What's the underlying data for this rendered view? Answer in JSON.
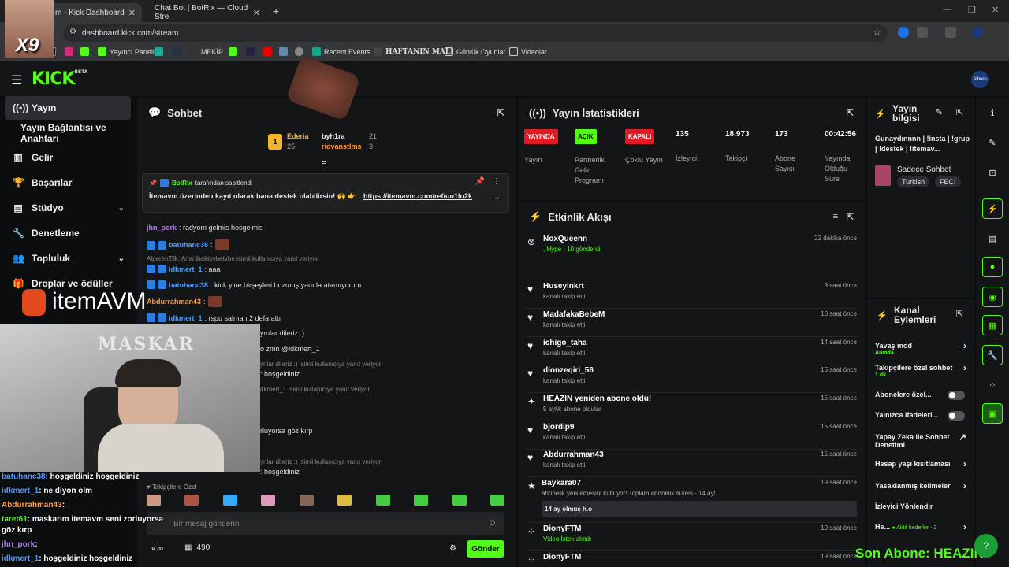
{
  "browser": {
    "tabs": [
      {
        "label": "m - Kick Dashboard"
      },
      {
        "label": "Chat Bot | BotRix — Cloud Stre"
      }
    ],
    "url": "dashboard.kick.com/stream",
    "bookmarks": [
      "Yayıncı Paneli",
      "MEKİP",
      "Recent Events",
      "HAFTANIN MALI",
      "Günlük Oyunlar",
      "Videolar"
    ]
  },
  "kick": {
    "logo": "KICK",
    "logo_sup": "BETA",
    "avatar_label": "Alburo"
  },
  "sidebar": {
    "items": [
      {
        "label": "Yayın",
        "icon": "broadcast-icon"
      },
      {
        "label": "Yayın Bağlantısı ve Anahtarı",
        "icon": ""
      },
      {
        "label": "Gelir",
        "icon": "chart-icon"
      },
      {
        "label": "Başarılar",
        "icon": "trophy-icon"
      },
      {
        "label": "Stüdyo",
        "icon": "studio-icon"
      },
      {
        "label": "Denetleme",
        "icon": "wrench-icon"
      },
      {
        "label": "Topluluk",
        "icon": "people-icon"
      },
      {
        "label": "Droplar ve ödüller",
        "icon": "gift-icon"
      }
    ]
  },
  "chat": {
    "title": "Sohbet",
    "leaders": [
      {
        "rank": "1",
        "name": "Ederia",
        "value": "25"
      },
      {
        "name": "byh1ra",
        "value": "21"
      },
      {
        "name": "ridvanstlms",
        "value": "3"
      }
    ],
    "pinned": {
      "by": "BotRix",
      "by_suffix": "tarafından sabitlendi",
      "text": "İtemavm üzerinden kayıt olarak bana destek olabilirsin! 🙌 👉",
      "link": "https://itemavm.com/ref/uo1lu2k"
    },
    "lines": [
      {
        "user": "jhn_pork",
        "text": ": radyom gelmis hosgelmis",
        "color": "#b874ff"
      },
      {
        "user": "batuhanc38",
        "text": ":",
        "color": "#4f9cff"
      },
      {
        "reply": "AlperenTilk: Ananibaktovbetvbe isimli kullanıcıya yanıt veriyor"
      },
      {
        "user": "idkmert_1",
        "text": ": aaa",
        "color": "#4f9cff"
      },
      {
        "user": "batuhanc38",
        "text": ": kick yine birşeyleri bozmuş yanıtla atamıyorum",
        "color": "#4f9cff"
      },
      {
        "user": "Abdurrahman43",
        "text": ":",
        "color": "#ff9a3c"
      },
      {
        "user": "idkmert_1",
        "text": ": rspu salman 2 defa attı",
        "color": "#4f9cff"
      },
      {
        "user": "",
        "text": "yınlar dileriz :)",
        "color": "#ddd"
      },
      {
        "user": "",
        "text": "o zmn @idkmert_1",
        "color": "#ddd"
      },
      {
        "reply": "ynlar dileriz :) isimli kullanıcıya yanıt veriyor"
      },
      {
        "user": "",
        "text": ": hoşgeldiniz",
        "color": "#ddd"
      },
      {
        "reply": "dkmert_1 isimli kullanıcıya yanıt veriyor"
      },
      {
        "user": "",
        "text": "rluyorsa göz kırp",
        "color": "#ddd"
      },
      {
        "reply": "ynlar dileriz :) isimli kullanıcıya yanıt veriyor"
      },
      {
        "user": "",
        "text": ": hoşgeldiniz",
        "color": "#ddd"
      }
    ],
    "emote_label": "Takipçilere Özel",
    "input_placeholder": "Bir mesaj gönderin",
    "points": "490",
    "send_label": "Gönder"
  },
  "stats": {
    "title": "Yayın İstatistikleri",
    "items": [
      {
        "pill": "YAYINDA",
        "pill_color": "#e01b24",
        "label": "Yayın"
      },
      {
        "pill": "AÇIK",
        "pill_color": "#53fc18",
        "label": "Partnerlik Gelir Programı"
      },
      {
        "pill": "KAPALI",
        "pill_color": "#e01b24",
        "label": "Çoklu Yayın"
      },
      {
        "value": "135",
        "label": "İzleyici"
      },
      {
        "value": "18.973",
        "label": "Takipçi"
      },
      {
        "value": "173",
        "label": "Abone Sayısı"
      },
      {
        "value": "00:42:56",
        "label": "Yayında Olduğu Süre"
      }
    ]
  },
  "activity": {
    "title": "Etkinlik Akışı",
    "items": [
      {
        "who": "NoxQueenn",
        "what": ", Hype · 10 gönderdi",
        "when": "22 dakika önce",
        "icon": "kick-icon"
      },
      {
        "who": "Huseyinkrt",
        "what": "kanalı takip etti",
        "when": "9 saat önce",
        "icon": "heart-icon"
      },
      {
        "who": "MadafakaBebeM",
        "what": "kanalı takip etti",
        "when": "10 saat önce",
        "icon": "heart-icon"
      },
      {
        "who": "ichigo_taha",
        "what": "kanalı takip etti",
        "when": "14 saat önce",
        "icon": "heart-icon"
      },
      {
        "who": "dionzeqiri_56",
        "what": "kanalı takip etti",
        "when": "15 saat önce",
        "icon": "heart-icon"
      },
      {
        "who": "HEAZIN yeniden abone oldu!",
        "what": "5 aylık abone oldular",
        "when": "15 saat önce",
        "icon": "sparkle-icon"
      },
      {
        "who": "bjordip9",
        "what": "kanalı takip etti",
        "when": "15 saat önce",
        "icon": "heart-icon"
      },
      {
        "who": "Abdurrahman43",
        "what": "kanalı takip etti",
        "when": "15 saat önce",
        "icon": "heart-icon"
      },
      {
        "who": "Baykara07",
        "what": "abonelik yenilemesini kutluyor! Toplam abonelik süresi - 14 ay!",
        "when": "19 saat önce",
        "icon": "star-icon",
        "note": "14 ay olmuş h.o"
      },
      {
        "who": "DionyFTM",
        "what": "Video İstek alındı",
        "when": "19 saat önce",
        "icon": "dots-icon"
      },
      {
        "who": "DionyFTM",
        "what": "",
        "when": "19 saat önce",
        "icon": "dots-icon"
      }
    ]
  },
  "info": {
    "title": "Yayın bilgisi",
    "stream_title": "Gunaydınnnn | !insta | !grup | !destek | !itemav...",
    "category": "Sadece Sohbet",
    "tags": [
      "Turkish",
      "FECİ"
    ]
  },
  "actions": {
    "title": "Kanal Eylemleri",
    "rows": [
      {
        "label": "Yavaş mod",
        "sub": "Anında",
        "ctl": "arrow"
      },
      {
        "label": "Takipçilere özel sohbet",
        "sub": "1 dk.",
        "ctl": "arrow"
      },
      {
        "label": "Abonelere özel...",
        "sub": "",
        "ctl": "toggle"
      },
      {
        "label": "Yalnızca ifadeleri...",
        "sub": "",
        "ctl": "toggle"
      },
      {
        "label": "Yapay Zeka ile Sohbet Denetimi",
        "sub": "",
        "ctl": "ext"
      },
      {
        "label": "Hesap yaşı kısıtlaması",
        "sub": "",
        "ctl": "arrow"
      },
      {
        "label": "Yasaklanmış kelimeler",
        "sub": "",
        "ctl": "arrow"
      },
      {
        "label": "İzleyici Yönlendir",
        "sub": "",
        "ctl": ""
      },
      {
        "label": "He...",
        "sub": "Aktif hedefler - 2",
        "ctl": "arrow"
      }
    ]
  },
  "overlay": {
    "brand": "itemAVM",
    "watermark": "MASKAR",
    "lines": [
      {
        "user": "batuhanc38",
        "text": ": hoşgeldiniz hoşgeldiniz",
        "color": "#4f9cff"
      },
      {
        "user": "idkmert_1",
        "text": ": ne diyon olm",
        "color": "#4f9cff"
      },
      {
        "user": "Abdurrahman43",
        "text": ":",
        "color": "#ff9a3c"
      },
      {
        "user": "taret61",
        "text": ": maskarım itemavm seni zorluyorsa",
        "color": "#53fc18"
      },
      {
        "user": "",
        "text": "göz kırp",
        "color": "#fff"
      },
      {
        "user": "jhn_pork",
        "text": ":",
        "color": "#b874ff"
      },
      {
        "user": "idkmert_1",
        "text": ": hoşgeldiniz hoşgeldiniz",
        "color": "#4f9cff"
      }
    ],
    "last_sub": "Son Abone: HEAZIN",
    "x9": "X9"
  }
}
